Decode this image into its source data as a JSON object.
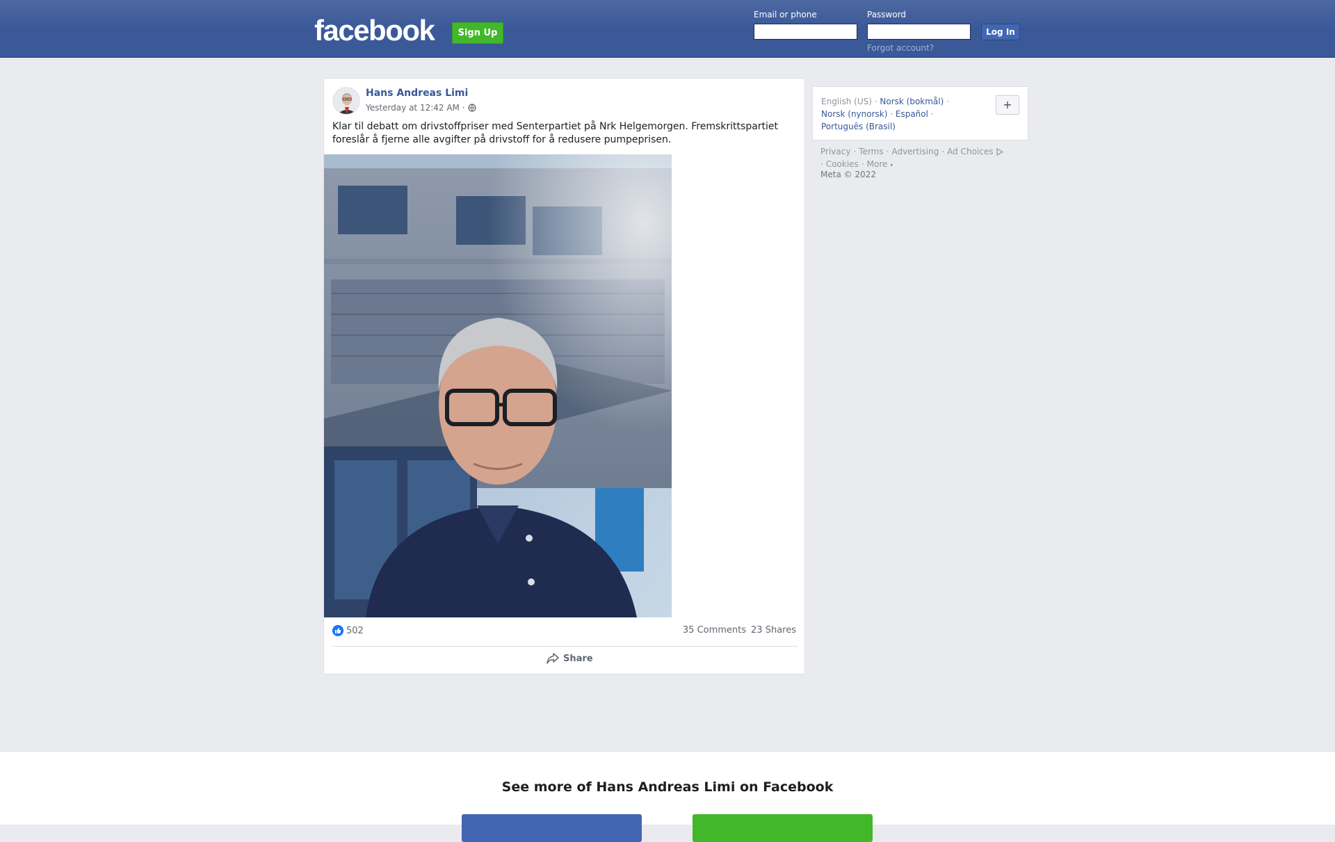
{
  "header": {
    "logo": "facebook",
    "signup_label": "Sign Up",
    "email_label": "Email or phone",
    "password_label": "Password",
    "email_value": "",
    "password_value": "",
    "login_label": "Log In",
    "forgot_label": "Forgot account?"
  },
  "post": {
    "author": "Hans Andreas Limi",
    "time": "Yesterday at 12:42 AM ·",
    "text": "Klar til debatt om drivstoffpriser med Senterpartiet på Nrk Helgemorgen. Fremskrittspartiet foreslår å fjerne alle avgifter på drivstoff for å redusere pumpeprisen.",
    "likes": "502",
    "comments": "35 Comments",
    "shares": "23 Shares",
    "share_label": "Share"
  },
  "languages": {
    "current": "English (US)",
    "others": [
      "Norsk (bokmål)",
      "Norsk (nynorsk)",
      "Español",
      "Português (Brasil)"
    ],
    "plus_label": "+"
  },
  "footer": {
    "links": [
      "Privacy",
      "Terms",
      "Advertising",
      "Ad Choices",
      "Cookies",
      "More"
    ],
    "copyright": "Meta © 2022"
  },
  "banner": {
    "title": "See more of Hans Andreas Limi on Facebook"
  },
  "colors": {
    "brand_blue": "#3b5998",
    "signup_green": "#42b72a",
    "link_blue": "#385898"
  }
}
